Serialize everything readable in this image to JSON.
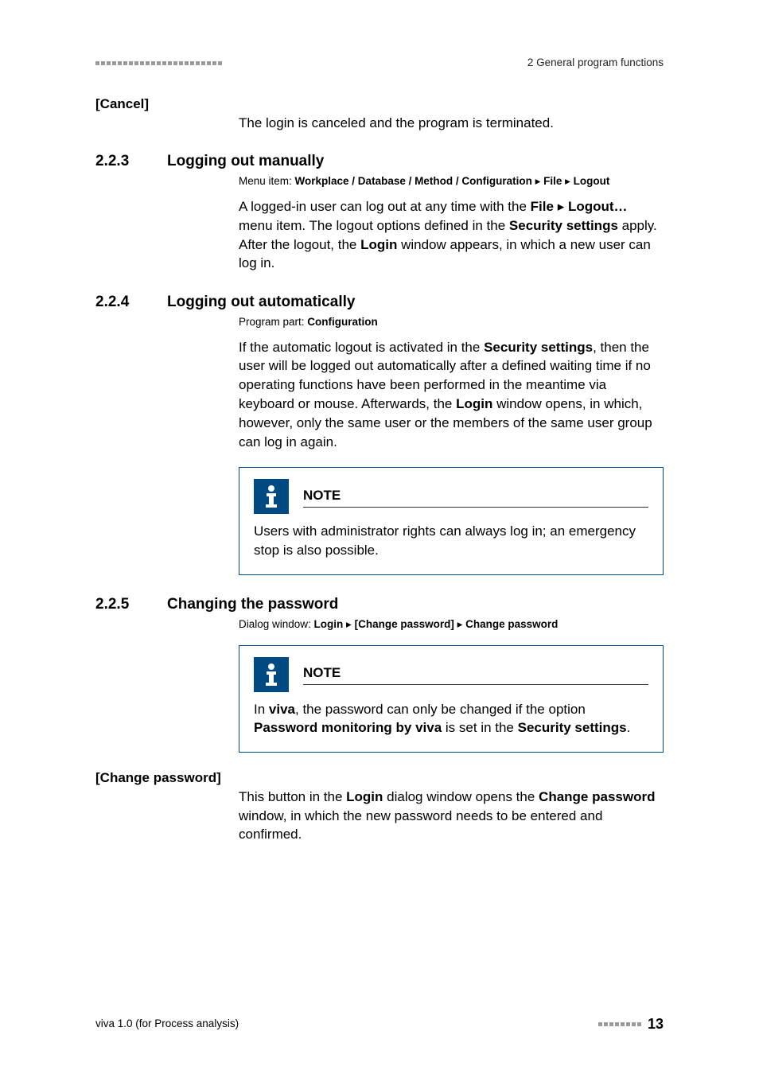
{
  "header": {
    "chapter_label": "2 General program functions"
  },
  "cancel": {
    "heading": "[Cancel]",
    "text": "The login is canceled and the program is terminated."
  },
  "s223": {
    "num": "2.2.3",
    "title": "Logging out manually",
    "meta_prefix": "Menu item: ",
    "meta_path": "Workplace / Database / Method / Configuration",
    "meta_sep1": " ▸ ",
    "meta_file": "File",
    "meta_sep2": " ▸ ",
    "meta_logout": "Logout",
    "p1a": "A logged-in user can log out at any time with the ",
    "p1b": "File",
    "p1c": " ▸ ",
    "p1d": "Logout…",
    "p1e": " menu item. The logout options defined in the ",
    "p1f": "Security settings",
    "p1g": " apply. After the logout, the ",
    "p1h": "Login",
    "p1i": " window appears, in which a new user can log in."
  },
  "s224": {
    "num": "2.2.4",
    "title": "Logging out automatically",
    "meta_prefix": "Program part: ",
    "meta_conf": "Configuration",
    "p1a": "If the automatic logout is activated in the ",
    "p1b": "Security settings",
    "p1c": ", then the user will be logged out automatically after a defined waiting time if no operating functions have been performed in the meantime via keyboard or mouse. Afterwards, the ",
    "p1d": "Login",
    "p1e": " window opens, in which, however, only the same user or the members of the same user group can log in again.",
    "note_title": "NOTE",
    "note_body": "Users with administrator rights can always log in; an emergency stop is also possible."
  },
  "s225": {
    "num": "2.2.5",
    "title": "Changing the password",
    "meta_prefix": "Dialog window: ",
    "meta_login": "Login",
    "meta_sep1": " ▸ ",
    "meta_chpw_btn": "[Change password]",
    "meta_sep2": " ▸ ",
    "meta_chpw": "Change password",
    "note_title": "NOTE",
    "note_a": "In ",
    "note_b": "viva",
    "note_c": ", the password can only be changed if the option ",
    "note_d": "Password monitoring by viva",
    "note_e": " is set in the ",
    "note_f": "Security settings",
    "note_g": "."
  },
  "changepw": {
    "heading": "[Change password]",
    "p1a": "This button in the ",
    "p1b": "Login",
    "p1c": " dialog window opens the ",
    "p1d": "Change password",
    "p1e": " window, in which the new password needs to be entered and confirmed."
  },
  "footer": {
    "left": "viva 1.0 (for Process analysis)",
    "page": "13"
  }
}
